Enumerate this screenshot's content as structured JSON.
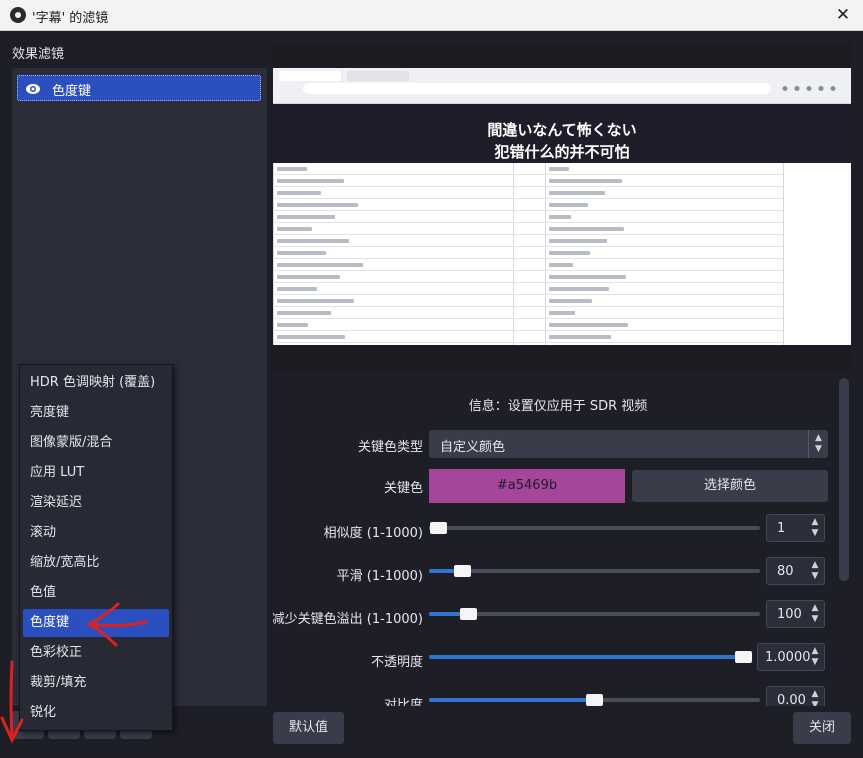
{
  "window": {
    "title": "'字幕' 的滤镜",
    "close_glyph": "✕"
  },
  "effects": {
    "section_label": "效果滤镜",
    "filters": [
      {
        "name": "色度键",
        "visible": true
      }
    ]
  },
  "preview": {
    "banner_jp": "間違いなんて怖くない",
    "banner_cn": "犯错什么的并不可怕"
  },
  "properties": {
    "info": "信息：设置仅应用于 SDR 视频",
    "key_color_type": {
      "label": "关键色类型",
      "value": "自定义颜色"
    },
    "key_color": {
      "label": "关键色",
      "hex": "#a5469b",
      "pick_button": "选择颜色"
    },
    "similarity": {
      "label": "相似度 (1-1000)",
      "value": "1",
      "fraction": 0.003
    },
    "smoothness": {
      "label": "平滑 (1-1000)",
      "value": "80",
      "fraction": 0.08
    },
    "spill": {
      "label": "减少关键色溢出 (1-1000)",
      "value": "100",
      "fraction": 0.1
    },
    "opacity": {
      "label": "不透明度",
      "value": "1.0000",
      "fraction": 1.0
    },
    "contrast": {
      "label": "对比度",
      "value": "0.00",
      "fraction": 0.5
    }
  },
  "footer": {
    "defaults_button": "默认值",
    "close_button": "关闭"
  },
  "add_filter_menu": {
    "items": [
      "HDR 色调映射 (覆盖)",
      "亮度键",
      "图像蒙版/混合",
      "应用 LUT",
      "渲染延迟",
      "滚动",
      "缩放/宽高比",
      "色值",
      "色度键",
      "色彩校正",
      "裁剪/填充",
      "锐化"
    ],
    "selected": "色度键"
  },
  "colors": {
    "accent": "#2b4fbe",
    "key_color": "#a5469b",
    "slider_fill": "#2f74d0",
    "annotation_red": "#e02020"
  }
}
